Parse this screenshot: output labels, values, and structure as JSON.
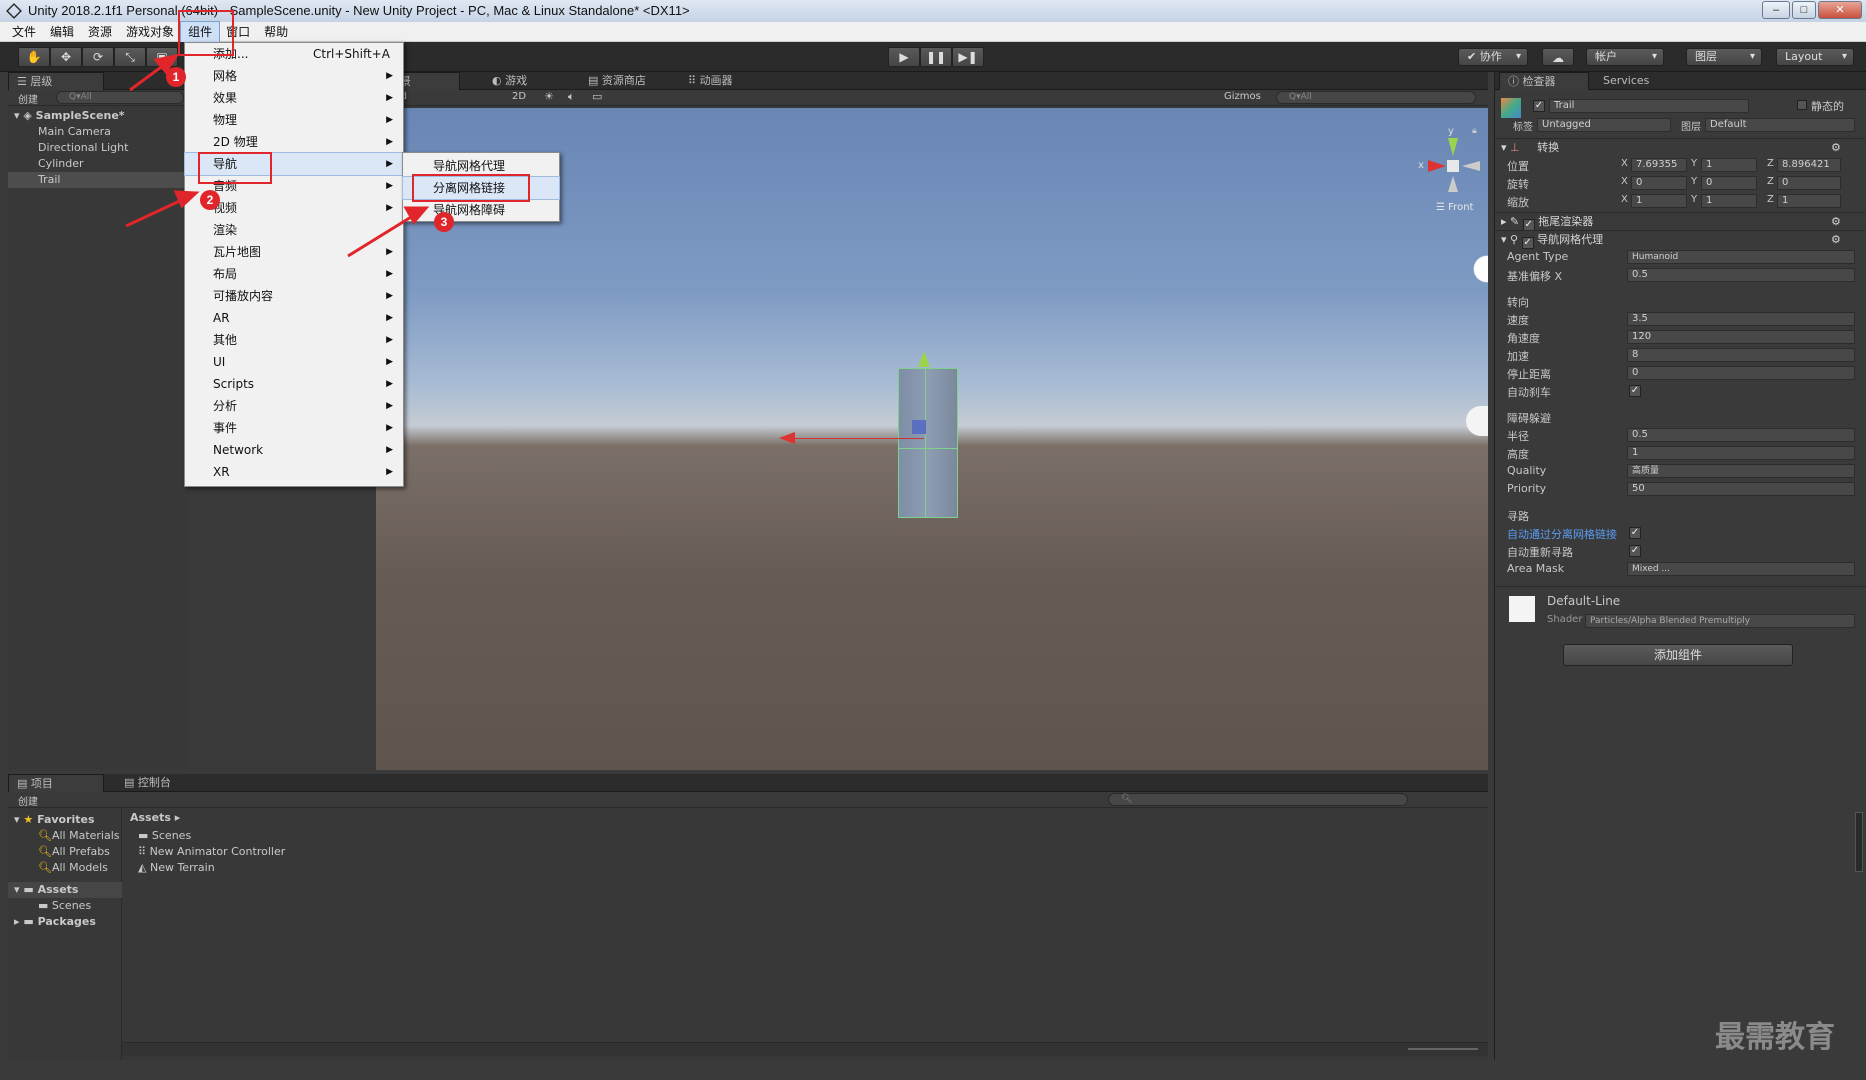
{
  "window": {
    "title": "Unity 2018.2.1f1 Personal (64bit) - SampleScene.unity - New Unity Project - PC, Mac & Linux Standalone* <DX11>"
  },
  "menubar": {
    "items": [
      "文件",
      "编辑",
      "资源",
      "游戏对象",
      "组件",
      "窗口",
      "帮助"
    ]
  },
  "toolbar": {
    "collab": "协作",
    "account": "帐户",
    "layers": "图层",
    "layout": "Layout"
  },
  "hierarchy": {
    "tab": "层级",
    "create": "创建",
    "search_placeholder": "Q▾All",
    "scene": "SampleScene*",
    "items": [
      "Main Camera",
      "Directional Light",
      "Cylinder",
      "Trail"
    ]
  },
  "scene_view": {
    "tabs": [
      "场景",
      "游戏",
      "资源商店",
      "动画器"
    ],
    "shading": "aded",
    "mode_2d": "2D",
    "gizmos": "Gizmos",
    "search": "Q▾All",
    "gizmo": {
      "x": "x",
      "y": "y",
      "view": "Front"
    }
  },
  "component_menu": {
    "items": [
      {
        "label": "添加...",
        "shortcut": "Ctrl+Shift+A"
      },
      {
        "label": "网格",
        "submenu": true
      },
      {
        "label": "效果",
        "submenu": true
      },
      {
        "label": "物理",
        "submenu": true
      },
      {
        "label": "2D 物理",
        "submenu": true
      },
      {
        "label": "导航",
        "submenu": true
      },
      {
        "label": "音频",
        "submenu": true
      },
      {
        "label": "视频",
        "submenu": true
      },
      {
        "label": "渲染",
        "submenu": false
      },
      {
        "label": "瓦片地图",
        "submenu": true
      },
      {
        "label": "布局",
        "submenu": true
      },
      {
        "label": "可播放内容",
        "submenu": true
      },
      {
        "label": "AR",
        "submenu": true
      },
      {
        "label": "其他",
        "submenu": true
      },
      {
        "label": "UI",
        "submenu": true
      },
      {
        "label": "Scripts",
        "submenu": true
      },
      {
        "label": "分析",
        "submenu": true
      },
      {
        "label": "事件",
        "submenu": true
      },
      {
        "label": "Network",
        "submenu": true
      },
      {
        "label": "XR",
        "submenu": true
      }
    ],
    "nav_submenu": [
      "导航网格代理",
      "分离网格链接",
      "导航网格障碍"
    ]
  },
  "annotations": {
    "badges": [
      "1",
      "2",
      "3"
    ]
  },
  "inspector": {
    "tabs": [
      "检查器",
      "Services"
    ],
    "object_name": "Trail",
    "static": "静态的",
    "tag_label": "标签",
    "tag": "Untagged",
    "layer_label": "图层",
    "layer": "Default",
    "transform": {
      "title": "转换",
      "rows": [
        {
          "label": "位置",
          "x": "7.69355",
          "y": "1",
          "z": "8.896421"
        },
        {
          "label": "旋转",
          "x": "0",
          "y": "0",
          "z": "0"
        },
        {
          "label": "缩放",
          "x": "1",
          "y": "1",
          "z": "1"
        }
      ],
      "axis": [
        "X",
        "Y",
        "Z"
      ]
    },
    "trail_renderer": "拖尾渲染器",
    "nav_agent": {
      "title": "导航网格代理",
      "agent_type_label": "Agent Type",
      "agent_type": "Humanoid",
      "base_offset_label": "基准偏移 X",
      "base_offset": "0.5",
      "steering_header": "转向",
      "speed_label": "速度",
      "speed": "3.5",
      "angular_label": "角速度",
      "angular": "120",
      "accel_label": "加速",
      "accel": "8",
      "stop_label": "停止距离",
      "stop": "0",
      "autobrake_label": "自动刹车",
      "avoid_header": "障碍躲避",
      "radius_label": "半径",
      "radius": "0.5",
      "height_label": "高度",
      "height": "1",
      "quality_label": "Quality",
      "quality": "高质量",
      "priority_label": "Priority",
      "priority": "50",
      "path_header": "寻路",
      "auto_traverse_label": "自动通过分离网格链接",
      "auto_repath_label": "自动重新寻路",
      "area_mask_label": "Area Mask",
      "area_mask": "Mixed ..."
    },
    "material": {
      "name": "Default-Line",
      "shader_label": "Shader",
      "shader": "Particles/Alpha Blended Premultiply"
    },
    "add_component": "添加组件"
  },
  "project": {
    "tabs": [
      "项目",
      "控制台"
    ],
    "create": "创建",
    "favorites_header": "Favorites",
    "favorites": [
      "All Materials",
      "All Prefabs",
      "All Models"
    ],
    "assets_header": "Assets",
    "assets_children": [
      "Scenes"
    ],
    "packages": "Packages",
    "breadcrumb": "Assets",
    "files": [
      "Scenes",
      "New Animator Controller",
      "New Terrain"
    ]
  },
  "watermark": "最需教育"
}
